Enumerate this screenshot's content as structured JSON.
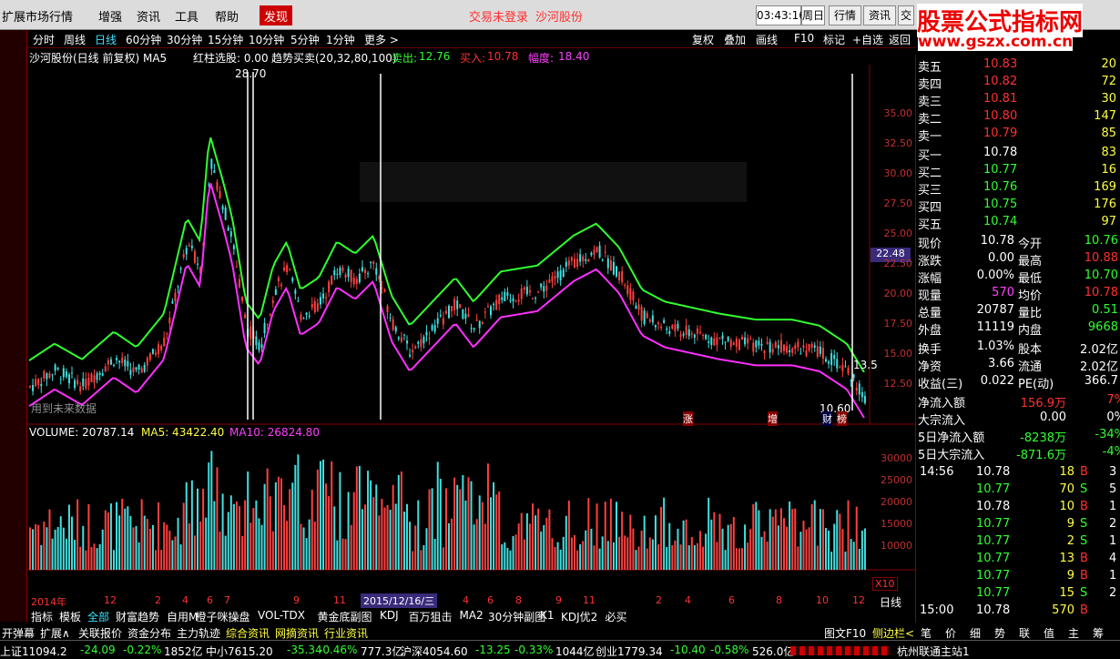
{
  "topbar": {
    "menus": [
      "扩展市场行情",
      "增强",
      "资讯",
      "工具",
      "帮助"
    ],
    "discover": "发现",
    "notice1": "交易未登录",
    "notice2": "沙河股份",
    "clock": "03:43:16",
    "day": "周日",
    "right_tabs": [
      "行情",
      "资讯",
      "交"
    ],
    "watermark1": "股票公式指标网",
    "watermark2": "www.gszx.com.cn"
  },
  "periods": [
    "分时",
    "周线",
    "日线",
    "60分钟",
    "30分钟",
    "15分钟",
    "10分钟",
    "5分钟",
    "1分钟",
    "更多 >"
  ],
  "toolbar": [
    "复权",
    "叠加",
    "画线",
    "F10",
    "标记",
    "+自选",
    "返回"
  ],
  "chart_info": {
    "name": "沙河股份(日线 前复权) MA5",
    "red_select": "红柱选股: 0.00",
    "trend": "趋势买卖(20,32,80,100)",
    "sell_label": "卖出:",
    "sell_val": "12.76",
    "buy_label": "买入:",
    "buy_val": "10.78",
    "amp_label": "幅度:",
    "amp_val": "18.40",
    "high_mark": "28.70",
    "low_mark": "10.60",
    "price_tag": "22.48",
    "right_mark": "13.5",
    "future": "用到未来数据"
  },
  "price_ticks": [
    "35.00",
    "32.50",
    "30.00",
    "27.50",
    "25.00",
    "22.50",
    "20.00",
    "17.50",
    "15.00",
    "12.50"
  ],
  "volume_info": {
    "label": "VOLUME: 20787.14",
    "ma5": "MA5: 43422.40",
    "ma10": "MA10: 26824.80",
    "unit": "X10"
  },
  "vol_ticks": [
    "30000",
    "25000",
    "20000",
    "15000",
    "10000"
  ],
  "x_axis": {
    "start": "2014年",
    "labels": [
      "12",
      "2",
      "4",
      "6",
      "7",
      "9",
      "11",
      "4",
      "6",
      "8",
      "9",
      "11",
      "2",
      "4",
      "6",
      "8",
      "10",
      "12"
    ],
    "cursor_date": "2015/12/16/三",
    "period": "日线"
  },
  "markers": [
    "涨",
    "增",
    "财",
    "榜"
  ],
  "orderbook": {
    "sell": [
      {
        "l": "卖五",
        "p": "10.83",
        "v": "20"
      },
      {
        "l": "卖四",
        "p": "10.82",
        "v": "72"
      },
      {
        "l": "卖三",
        "p": "10.81",
        "v": "30"
      },
      {
        "l": "卖二",
        "p": "10.80",
        "v": "147"
      },
      {
        "l": "卖一",
        "p": "10.79",
        "v": "85"
      }
    ],
    "buy": [
      {
        "l": "买一",
        "p": "10.78",
        "v": "83"
      },
      {
        "l": "买二",
        "p": "10.77",
        "v": "16"
      },
      {
        "l": "买三",
        "p": "10.76",
        "v": "169"
      },
      {
        "l": "买四",
        "p": "10.75",
        "v": "176"
      },
      {
        "l": "买五",
        "p": "10.74",
        "v": "97"
      }
    ]
  },
  "stats": [
    [
      "现价",
      "10.78",
      "今开",
      "10.76"
    ],
    [
      "涨跌",
      "0.00",
      "最高",
      "10.88"
    ],
    [
      "涨幅",
      "0.00%",
      "最低",
      "10.70"
    ],
    [
      "现量",
      "570",
      "均价",
      "10.78"
    ],
    [
      "总量",
      "20787",
      "量比",
      "0.51"
    ],
    [
      "外盘",
      "11119",
      "内盘",
      "9668"
    ],
    [
      "换手",
      "1.03%",
      "股本",
      "2.02亿"
    ],
    [
      "净资",
      "3.66",
      "流通",
      "2.02亿"
    ],
    [
      "收益(三)",
      "0.022",
      "PE(动)",
      "366.7"
    ]
  ],
  "flows": [
    [
      "净流入额",
      "156.9万",
      "7%"
    ],
    [
      "大宗流入",
      "0.00",
      "0%"
    ],
    [
      "5日净流入额",
      "-8238万",
      "-34%"
    ],
    [
      "5日大宗流入",
      "-871.6万",
      "-4%"
    ]
  ],
  "ticks": [
    [
      "14:56",
      "10.78",
      "18",
      "B",
      "3"
    ],
    [
      "",
      "10.77",
      "70",
      "S",
      "5"
    ],
    [
      "",
      "10.78",
      "10",
      "B",
      "1"
    ],
    [
      "",
      "10.77",
      "9",
      "S",
      "2"
    ],
    [
      "",
      "10.77",
      "2",
      "S",
      "1"
    ],
    [
      "",
      "10.77",
      "13",
      "B",
      "4"
    ],
    [
      "",
      "10.77",
      "9",
      "B",
      "1"
    ],
    [
      "",
      "10.77",
      "15",
      "S",
      "2"
    ],
    [
      "15:00",
      "10.78",
      "570",
      "B",
      ""
    ]
  ],
  "indicator_tabs": [
    "指标",
    "模板",
    "全部",
    "财富趋势",
    "自用M",
    "橙子咪操盘",
    "VOL-TDX",
    "黄金底副图",
    "KDJ",
    "百万狙击",
    "MA2",
    "30分钟副图",
    "K1",
    "KDJ优2",
    "必买"
  ],
  "bottom_tabs": [
    "开弹幕",
    "扩展∧",
    "关联报价",
    "资金分布",
    "主力轨迹",
    "综合资讯",
    "网摘资讯",
    "行业资讯"
  ],
  "bottom_right": [
    "图文F10",
    "侧边栏<"
  ],
  "side_tabs": [
    "笔",
    "价",
    "细",
    "势",
    "联",
    "值",
    "主",
    "筹"
  ],
  "status": {
    "sh": "上证11094.2",
    "sh_chg": "-24.09",
    "sh_pct": "-0.22%",
    "sh_amt": "1852亿",
    "zx": "中小7615.20",
    "zx_chg": "-35.34",
    "zx_pct": "-0.46%",
    "zx_amt": "777.3亿",
    "hs": "沪深4054.60",
    "hs_chg": "-13.25",
    "hs_pct": "-0.33%",
    "hs_amt": "1044亿",
    "cy": "创业1779.34",
    "cy_chg": "-10.40",
    "cy_pct": "-0.58%",
    "cy_amt": "526.0亿",
    "site": "杭州联通主站1"
  }
}
